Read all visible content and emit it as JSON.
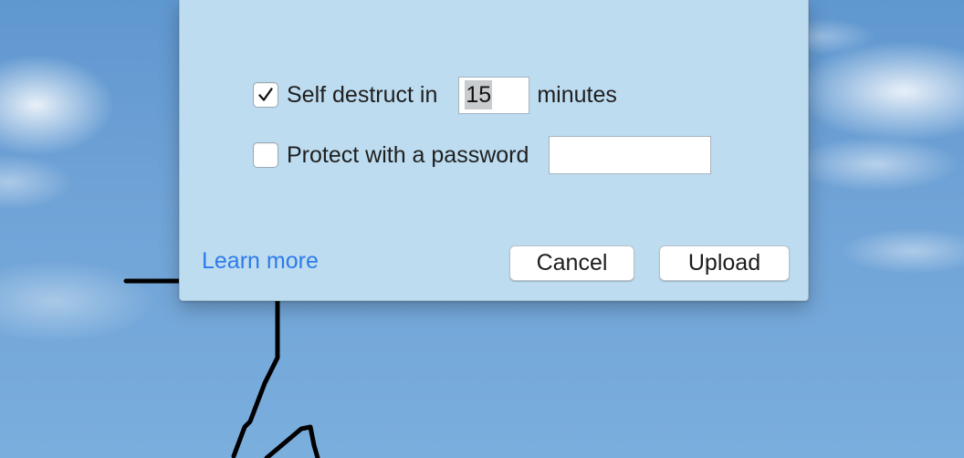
{
  "dialog": {
    "self_destruct": {
      "checked": true,
      "label": "Self destruct in",
      "minutes_value": "15",
      "unit_label": "minutes"
    },
    "password": {
      "checked": false,
      "label": "Protect with a password",
      "value": ""
    },
    "learn_more_label": "Learn more",
    "cancel_label": "Cancel",
    "upload_label": "Upload"
  },
  "icons": {
    "checkmark": "checkmark-icon"
  },
  "colors": {
    "sheet_background": "#bddcf0",
    "link": "#2f7be8",
    "desktop_sky": "#6fa2d6"
  }
}
